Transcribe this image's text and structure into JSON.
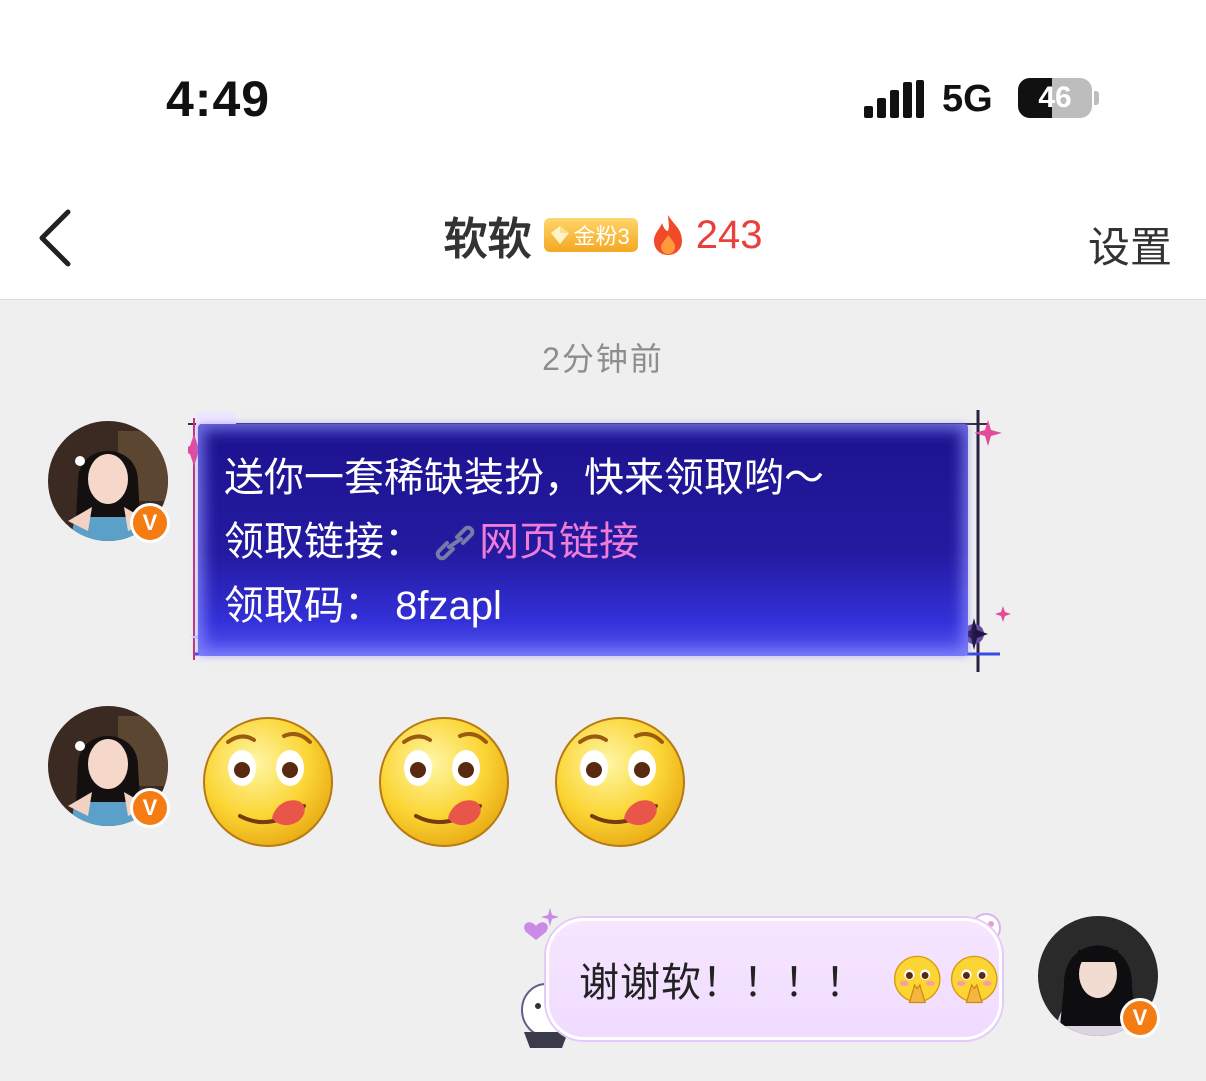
{
  "status_bar": {
    "time": "4:49",
    "network": "5G",
    "battery": "46",
    "battery_level": 0.46
  },
  "header": {
    "back_icon": "chevron-left-icon",
    "title": "软软",
    "fan_badge": "金粉3",
    "fire_count": "243",
    "settings_label": "设置"
  },
  "chat": {
    "timestamp": "2分钟前",
    "messages": [
      {
        "sender": "other",
        "type": "card",
        "line1": "送你一套稀缺装扮，快来领取哟～",
        "line2_label": "领取链接：",
        "link_text": "网页链接",
        "line3_label": "领取码：",
        "code": "8fzapl"
      },
      {
        "sender": "other",
        "type": "emoji",
        "emojis": [
          "tongue-out-emoji",
          "tongue-out-emoji",
          "tongue-out-emoji"
        ]
      },
      {
        "sender": "self",
        "type": "text",
        "text": "谢谢软！！！！",
        "emojis": [
          "pleading-emoji",
          "pleading-emoji"
        ]
      }
    ]
  },
  "colors": {
    "fire_count": "#e9403b",
    "card_background": "#231aa0",
    "link": "#f07bd8",
    "bubble": "#f3e0ff",
    "verified_badge": "#f47c12"
  }
}
